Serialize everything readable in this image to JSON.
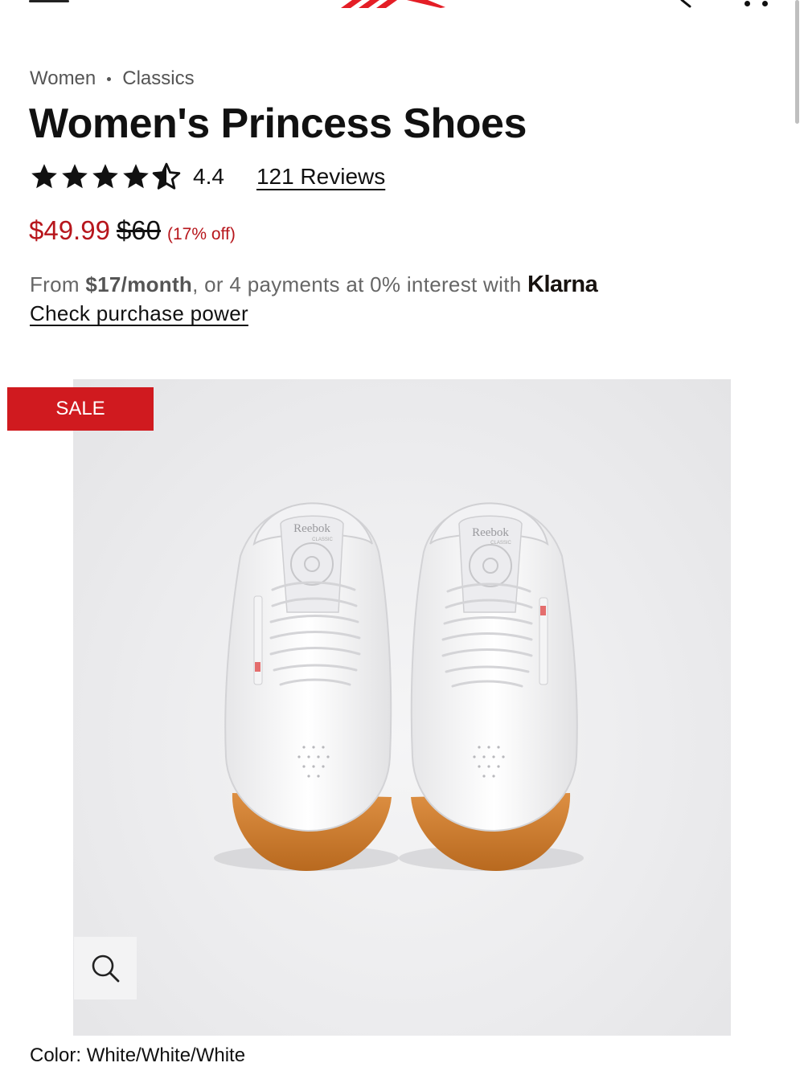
{
  "breadcrumb": {
    "items": [
      "Women",
      "Classics"
    ]
  },
  "product": {
    "title": "Women's Princess Shoes",
    "rating": "4.4",
    "stars": 4.5,
    "reviews": "121 Reviews",
    "price_sale": "$49.99",
    "price_original": "$60",
    "discount": "(17% off)",
    "badge": "SALE",
    "color": "Color: White/White/White"
  },
  "klarna": {
    "prefix": "From ",
    "amount": "$17/month",
    "suffix": ", or 4 payments at 0% interest with ",
    "brand": "Klarna",
    "link": "Check purchase power"
  },
  "shoe_text": {
    "brand": "Reebok",
    "sub": "CLASSIC"
  },
  "colors": {
    "sale_red": "#b7161c",
    "badge_red": "#d01a1f",
    "gum_sole": "#cf7f33"
  },
  "icons": [
    "menu-icon",
    "reebok-logo",
    "search-icon",
    "more-icon",
    "star-icon",
    "zoom-icon"
  ]
}
